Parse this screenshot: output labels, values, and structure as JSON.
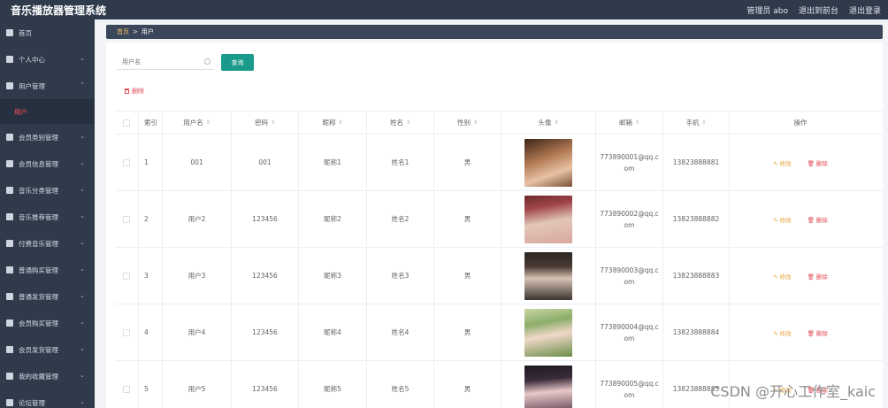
{
  "app": {
    "title": "音乐播放器管理系统",
    "admin_label": "管理员 abo",
    "to_frontend": "退出到前台",
    "logout": "退出登录"
  },
  "sidebar": {
    "items": [
      {
        "label": "首页",
        "icon": "home-icon"
      },
      {
        "label": "个人中心",
        "icon": "user-icon"
      },
      {
        "label": "用户管理",
        "icon": "users-icon"
      },
      {
        "label": "会员类别管理",
        "icon": "grid-icon"
      },
      {
        "label": "会员信息管理",
        "icon": "grid-icon"
      },
      {
        "label": "音乐分类管理",
        "icon": "music-icon"
      },
      {
        "label": "音乐推荐管理",
        "icon": "flag-icon"
      },
      {
        "label": "付费音乐管理",
        "icon": "card-icon"
      },
      {
        "label": "普通购买管理",
        "icon": "cart-icon"
      },
      {
        "label": "普通发货管理",
        "icon": "box-icon"
      },
      {
        "label": "会员购买管理",
        "icon": "grid-icon"
      },
      {
        "label": "会员发货管理",
        "icon": "mail-icon"
      },
      {
        "label": "我的收藏管理",
        "icon": "list-icon"
      },
      {
        "label": "论坛管理",
        "icon": "chat-icon"
      }
    ],
    "active_sub": "用户"
  },
  "breadcrumb": {
    "home": "首页",
    "sep": ">",
    "current": "用户"
  },
  "search": {
    "placeholder": "用户名",
    "button": "查询"
  },
  "delete_label": "删除",
  "table": {
    "headers": [
      "索引",
      "用户名",
      "密码",
      "昵称",
      "姓名",
      "性别",
      "头像",
      "邮箱",
      "手机",
      "操作"
    ],
    "rows": [
      {
        "idx": "1",
        "user": "001",
        "pwd": "001",
        "nick": "昵称1",
        "name": "姓名1",
        "sex": "男",
        "email": "773890001@qq.com",
        "phone": "13823888881"
      },
      {
        "idx": "2",
        "user": "用户2",
        "pwd": "123456",
        "nick": "昵称2",
        "name": "姓名2",
        "sex": "男",
        "email": "773890002@qq.com",
        "phone": "13823888882"
      },
      {
        "idx": "3",
        "user": "用户3",
        "pwd": "123456",
        "nick": "昵称3",
        "name": "姓名3",
        "sex": "男",
        "email": "773890003@qq.com",
        "phone": "13823888883"
      },
      {
        "idx": "4",
        "user": "用户4",
        "pwd": "123456",
        "nick": "昵称4",
        "name": "姓名4",
        "sex": "男",
        "email": "773890004@qq.com",
        "phone": "13823888884"
      },
      {
        "idx": "5",
        "user": "用户5",
        "pwd": "123456",
        "nick": "昵称5",
        "name": "姓名5",
        "sex": "男",
        "email": "773890005@qq.com",
        "phone": "13823888885"
      }
    ],
    "edit_label": "修改",
    "delete_label": "删除"
  },
  "watermark": "CSDN @开心工作室_kaic"
}
